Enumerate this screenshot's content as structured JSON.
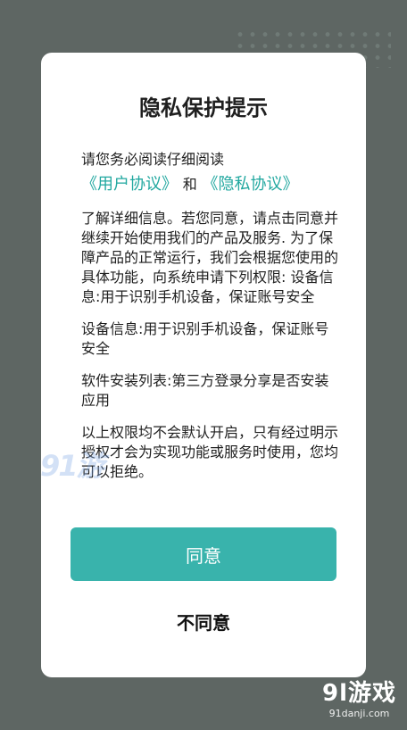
{
  "dialog": {
    "title": "隐私保护提示",
    "intro": "请您务必阅读仔细阅读",
    "link_user": "《用户协议》",
    "and_word": "和",
    "link_privacy": "《隐私协议》",
    "paragraph1": "了解详细信息。若您同意，请点击同意并继续开始使用我们的产品及服务. 为了保障产品的正常运行，我们会根据您使用的具体功能，向系统申请下列权限: 设备信息:用于识别手机设备，保证账号安全",
    "paragraph2": "设备信息:用于识别手机设备，保证账号安全",
    "paragraph3": "软件安装列表:第三方登录分享是否安装应用",
    "paragraph4": "以上权限均不会默认开启，只有经过明示授权才会为实现功能或服务时使用，您均可以拒绝。",
    "agree_label": "同意",
    "disagree_label": "不同意"
  },
  "watermark": {
    "left_text": "91游",
    "corner_main": "9l游戏",
    "corner_sub": "91danji.com"
  },
  "colors": {
    "background": "#5e6663",
    "accent": "#39b3ac",
    "link": "#22a8a0"
  }
}
